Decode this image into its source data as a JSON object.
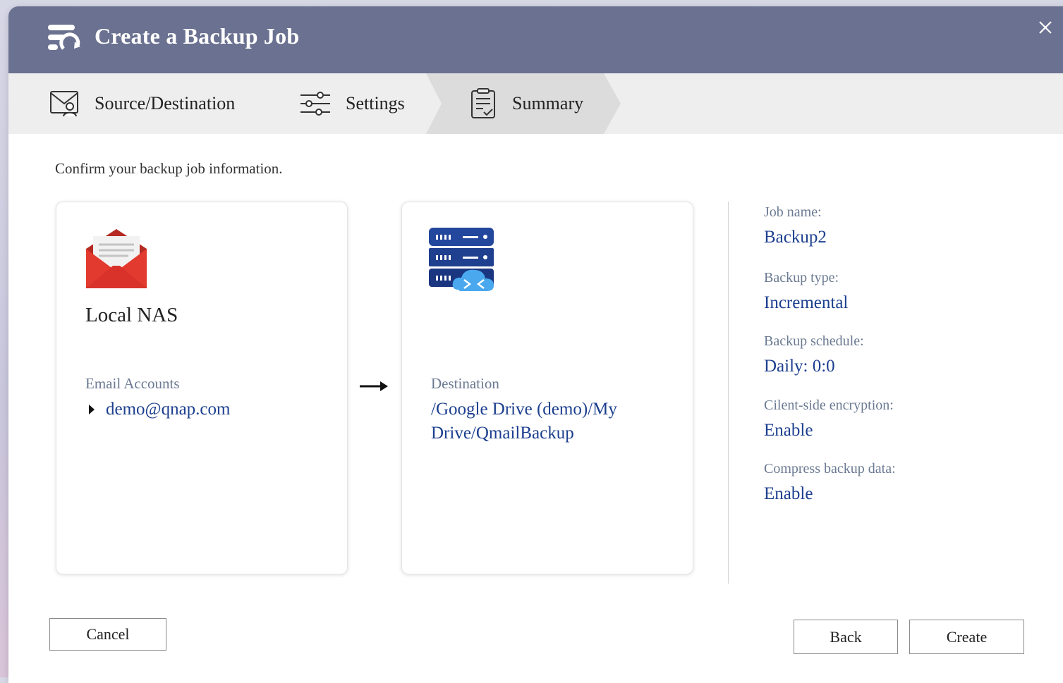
{
  "dialog": {
    "title": "Create a Backup Job",
    "title_icon": "backup-job-icon",
    "close_icon": "close-icon"
  },
  "steps": [
    {
      "label": "Source/Destination",
      "icon": "source-destination-icon",
      "active": false
    },
    {
      "label": "Settings",
      "icon": "settings-sliders-icon",
      "active": false
    },
    {
      "label": "Summary",
      "icon": "summary-clipboard-icon",
      "active": true
    }
  ],
  "instructions": "Confirm your backup job information.",
  "source": {
    "icon": "mail-envelope-icon",
    "title": "Local NAS",
    "section_label": "Email Accounts",
    "account": "demo@qnap.com"
  },
  "destination": {
    "icon": "server-cloud-icon",
    "section_label": "Destination",
    "path": "/Google Drive (demo)/My Drive/QmailBackup"
  },
  "summary": [
    {
      "label": "Job name:",
      "value": "Backup2"
    },
    {
      "label": "Backup type:",
      "value": "Incremental"
    },
    {
      "label": "Backup schedule:",
      "value": "Daily: 0:0"
    },
    {
      "label": "Cilent-side encryption:",
      "value": "Enable"
    },
    {
      "label": "Compress backup data:",
      "value": "Enable"
    }
  ],
  "buttons": {
    "cancel": "Cancel",
    "back": "Back",
    "create": "Create"
  },
  "colors": {
    "titlebar": "#6b7190",
    "stepbar": "#eeeeee",
    "step_active": "#dcdcdc",
    "value_text": "#1c3f8f",
    "label_text": "#6b7a92",
    "envelope_red": "#e23a2e",
    "server_blue": "#1f3f8f",
    "cloud_blue": "#4aa8ee"
  }
}
